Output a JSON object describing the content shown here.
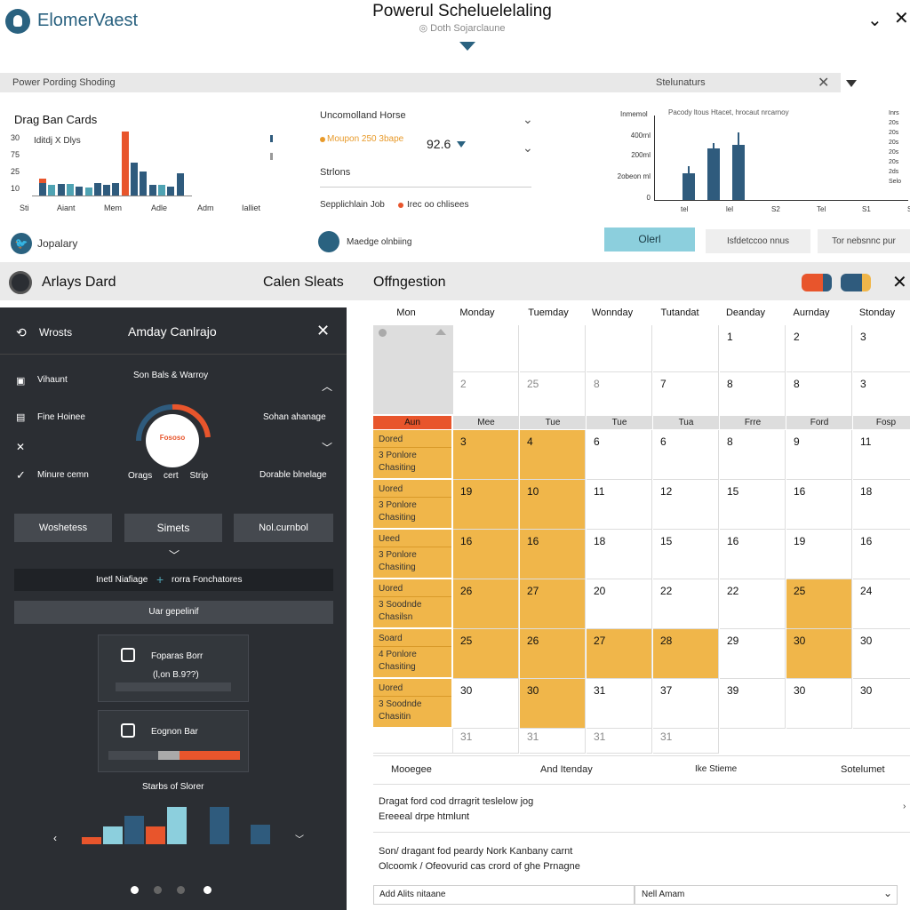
{
  "header": {
    "brand": "ElomerVaest",
    "title": "Powerul Scheluelelaling",
    "subtitle": "◎ Doth Sojarclaune"
  },
  "filter_bar": {
    "left_label": "Power Pording Shoding",
    "right_label": "Stelunaturs"
  },
  "widget_bars": {
    "title": "Drag Ban Cards",
    "legend": "Iditdj X Dlys",
    "yticks": [
      "30",
      "75",
      "25",
      "10"
    ],
    "xticks": [
      "Sti",
      "Aiant",
      "Mem",
      "Adle",
      "Adm",
      "Ialliet"
    ],
    "footer_label": "Jopalary"
  },
  "widget_mid": {
    "title": "Uncomolland Horse",
    "option_label": "Moupon 250 3bape",
    "value": "92.6",
    "section": "Strlons",
    "schedule_label": "Sepplichlain Job",
    "schedule_note": "Irec oo chlisees",
    "footer_label": "Maedge olnbiing"
  },
  "widget_chart": {
    "top_label": "Pacody ltous Htacet, hrocaut nrcarnoy",
    "ylabel": "Inmemol",
    "yticks": [
      "400rnl",
      "200ml",
      "2obeon ml",
      "0"
    ],
    "xticks": [
      "tel",
      "lel",
      "S2",
      "Tel",
      "S1",
      "S1"
    ],
    "right_ticks": [
      "Inrs",
      "20s",
      "20s",
      "20s",
      "20s",
      "20s",
      "2ds",
      "Selo"
    ]
  },
  "actions": {
    "primary": "Olerl",
    "secondary1": "Isfdetccoo nnus",
    "secondary2": "Tor nebsnnc pur"
  },
  "chart_data": [
    {
      "type": "bar",
      "categories": [
        "Sti",
        "Aiant",
        "Mem",
        "Adle",
        "Adm",
        "Ialliet"
      ],
      "series": [
        {
          "name": "",
          "values": [
            14,
            12,
            13,
            13,
            10,
            9,
            14,
            12,
            14,
            26,
            38,
            28,
            12,
            12,
            10,
            26
          ]
        },
        {
          "name": "",
          "values": [
            6,
            0,
            0,
            0,
            0,
            0,
            0,
            0,
            0,
            48,
            0,
            0,
            0,
            0,
            0,
            0
          ]
        }
      ]
    },
    {
      "type": "bar",
      "categories": [
        "tel",
        "lel",
        "S2",
        "Tel",
        "S1",
        "S1"
      ],
      "values": [
        30,
        58,
        62
      ]
    },
    {
      "type": "bar",
      "categories": [],
      "values": [
        8,
        20,
        32,
        20,
        42,
        42,
        22
      ]
    }
  ],
  "topband": {
    "left_title": "Arlays Dard",
    "mid_title": "Calen Sleats",
    "right_title": "Offngestion"
  },
  "side_panel": {
    "header_left": "Wrosts",
    "header_title": "Amday Canlrajo",
    "items": [
      "Vihaunt",
      "Fine Hoinee",
      "Minure cemn"
    ],
    "center_label": "Son Bals & Warroy",
    "right_items": [
      "Sohan ahanage",
      "Dorable blnelage"
    ],
    "gauge_label": "Fososo",
    "gauge_sub": "Orags cert Strip",
    "buttons": [
      "Woshetess",
      "Simets",
      "Nol.curnbol"
    ],
    "search_a": "Inetl Niafiage",
    "search_b": "rorra Fonchatores",
    "select_label": "Uar gepelinif",
    "card1_title": "Foparas Borr",
    "card1_value": "(l,on B.9??)",
    "card2_title": "Eognon Bar",
    "chart_label": "Starbs of Slorer"
  },
  "calendar": {
    "headers": [
      "Mon",
      "Monday",
      "Tuemday",
      "Wonnday",
      "Tutandat",
      "Deanday",
      "Aurnday",
      "Stonday"
    ],
    "day_labels": [
      "Aun",
      "Mee",
      "Tue",
      "Tue",
      "Tua",
      "Frre",
      "Ford",
      "Fosp"
    ],
    "top_rows": [
      [
        "",
        "",
        "",
        "",
        "1",
        "2",
        "3"
      ],
      [
        "2",
        "25",
        "8",
        "7",
        "8",
        "8",
        "3"
      ]
    ],
    "rows": [
      {
        "label": [
          "Dored",
          "3 Ponlore",
          "Chasiting"
        ],
        "cells": [
          "3",
          "4",
          "6",
          "6",
          "8",
          "9",
          "11"
        ],
        "yellow": [
          0,
          1
        ]
      },
      {
        "label": [
          "Uored",
          "3 Ponlore",
          "Chasiting"
        ],
        "cells": [
          "19",
          "10",
          "11",
          "12",
          "15",
          "16",
          "18"
        ],
        "yellow": [
          0,
          1
        ]
      },
      {
        "label": [
          "Ueed",
          "3 Ponlore",
          "Chasiting"
        ],
        "cells": [
          "16",
          "16",
          "18",
          "15",
          "16",
          "19",
          "16"
        ],
        "yellow": [
          0,
          1
        ]
      },
      {
        "label": [
          "Uored",
          "3 Soodnde",
          "Chasilsn"
        ],
        "cells": [
          "26",
          "27",
          "20",
          "22",
          "22",
          "25",
          "24"
        ],
        "yellow": [
          0,
          1,
          5
        ]
      },
      {
        "label": [
          "Soard",
          "4 Ponlore",
          "Chasiting"
        ],
        "cells": [
          "25",
          "26",
          "27",
          "28",
          "29",
          "30",
          "30"
        ],
        "yellow": [
          0,
          1,
          2,
          3,
          5
        ]
      },
      {
        "label": [
          "Uored",
          "3 Soodnde",
          "Chasitin"
        ],
        "cells": [
          "30",
          "30",
          "31",
          "37",
          "39",
          "30",
          "30"
        ],
        "yellow": [
          1
        ]
      }
    ],
    "last_row": [
      "31",
      "31",
      "31",
      "31"
    ]
  },
  "footer": {
    "cols": [
      "Mooegee",
      "And Itenday",
      "Ike Stieme",
      "Sotelumet"
    ],
    "line1": "Dragat ford cod drragrit teslelow jog",
    "line2": "Ereeeal drpe htmlunt",
    "line3": "Son/ dragant fod peardy Nork Kanbany carnt",
    "line4": "Olcoomk / Ofeovurid cas crord of ghe Prnagne",
    "select_left": "Add Alits nitaane",
    "select_right": "Nell Amam"
  },
  "colors": {
    "brand": "#2a6280",
    "orange": "#e8552c",
    "navy": "#2f5b7d",
    "teal": "#4fa3b3",
    "yellow": "#f0b64a",
    "dark_panel": "#2b2e33"
  }
}
